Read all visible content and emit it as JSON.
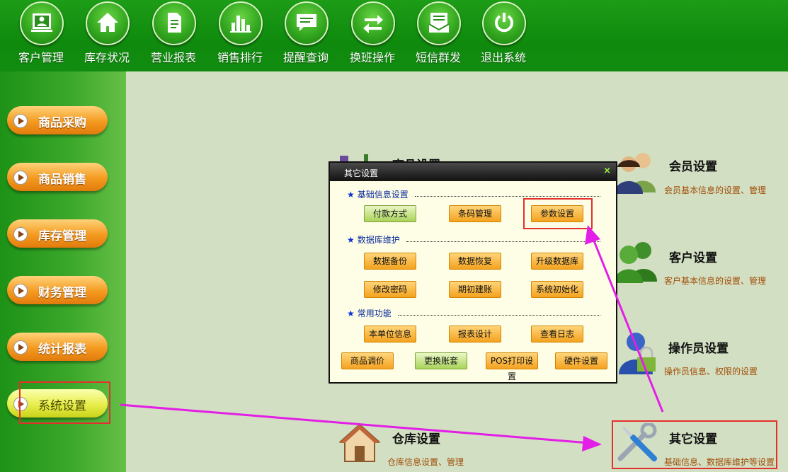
{
  "topbar": {
    "items": [
      {
        "label": "客户管理",
        "icon": "customer-icon"
      },
      {
        "label": "库存状况",
        "icon": "home-icon"
      },
      {
        "label": "营业报表",
        "icon": "report-icon"
      },
      {
        "label": "销售排行",
        "icon": "bar-chart-icon"
      },
      {
        "label": "提醒查询",
        "icon": "message-icon"
      },
      {
        "label": "换班操作",
        "icon": "swap-arrows-icon"
      },
      {
        "label": "短信群发",
        "icon": "sms-icon"
      },
      {
        "label": "退出系统",
        "icon": "power-icon"
      }
    ]
  },
  "sidebar": {
    "items": [
      {
        "label": "商品采购"
      },
      {
        "label": "商品销售"
      },
      {
        "label": "库存管理"
      },
      {
        "label": "财务管理"
      },
      {
        "label": "统计报表"
      },
      {
        "label": "系统设置",
        "active": true
      }
    ]
  },
  "settings": {
    "product": {
      "title": "商品设置"
    },
    "member": {
      "title": "会员设置",
      "desc": "会员基本信息的设置、管理"
    },
    "customer": {
      "title": "客户设置",
      "desc": "客户基本信息的设置、管理"
    },
    "operator": {
      "title": "操作员设置",
      "desc": "操作员信息、权限的设置"
    },
    "warehouse": {
      "title": "仓库设置",
      "desc": "仓库信息设置、管理"
    },
    "other": {
      "title": "其它设置",
      "desc": "基础信息、数据库维护等设置"
    }
  },
  "dialog": {
    "title": "其它设置",
    "close": "×",
    "sections": [
      {
        "title": "基础信息设置",
        "buttons": [
          "付款方式",
          "条码管理",
          "参数设置"
        ]
      },
      {
        "title": "数据库维护",
        "buttons": [
          "数据备份",
          "数据恢复",
          "升级数据库",
          "修改密码",
          "期初建账",
          "系统初始化"
        ]
      },
      {
        "title": "常用功能",
        "buttons": [
          "本单位信息",
          "报表设计",
          "查看日志"
        ]
      }
    ],
    "bottom_buttons": [
      "商品调价",
      "更换账套",
      "POS打印设置",
      "硬件设置"
    ]
  },
  "colors": {
    "accent_green": "#118c10",
    "highlight_red": "#e3302d",
    "arrow_magenta": "#e31ee6",
    "button_orange": "#f4a21f"
  }
}
